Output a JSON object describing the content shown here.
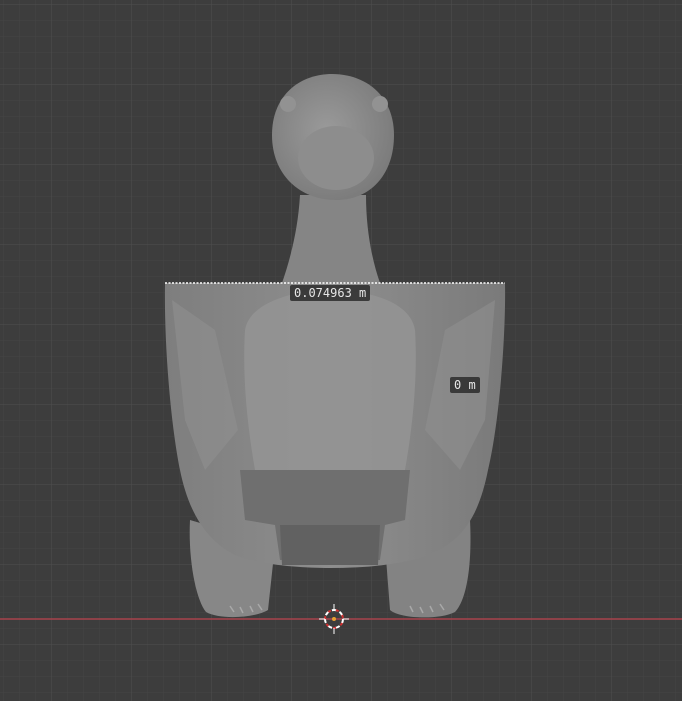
{
  "viewport": {
    "background_color": "#3d3d3d",
    "grid_minor_color": "#474747",
    "grid_major_color": "#505050",
    "x_axis_color": "#b0454f",
    "model_color": "#8a8a8a"
  },
  "measurements": {
    "length_label": "0.074963 m",
    "height_label": "0 m"
  },
  "cursor": {
    "icon": "3d-cursor-icon"
  }
}
